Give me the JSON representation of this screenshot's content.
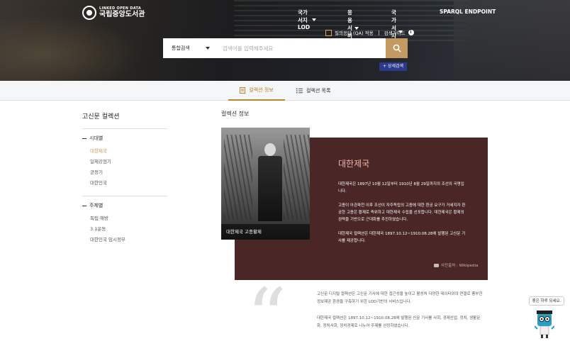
{
  "logo": {
    "sub": "LINKED OPEN DATA",
    "main": "국립중앙도서관"
  },
  "nav": [
    {
      "label": "국가서지 LOD",
      "dropdown": true
    },
    {
      "label": "응용서비스",
      "dropdown": true
    },
    {
      "label": "국가서지 컬스",
      "dropdown": true
    },
    {
      "label": "SPARQL ENDPOINT",
      "dropdown": false
    }
  ],
  "qa": {
    "label": "질의응답 (QA) 적용",
    "guide": "검색가이드"
  },
  "search": {
    "category": "통합검색",
    "placeholder": "검색어를 입력해주세요",
    "advanced": "+ 상세검색"
  },
  "tabs": [
    {
      "label": "컬렉션 정보",
      "active": true
    },
    {
      "label": "컬렉션 목록",
      "active": false
    }
  ],
  "sidebar": {
    "title": "고신문 컬렉션",
    "groups": [
      {
        "label": "시대별",
        "items": [
          "대한제국",
          "일제강점기",
          "군정기",
          "대한민국"
        ],
        "active": 0
      },
      {
        "label": "주제별",
        "items": [
          "독립·해방",
          "3.1운동",
          "대한민국 임시정부"
        ]
      }
    ]
  },
  "main": {
    "section_title": "컬렉션 정보",
    "photo_caption": "대한제국 고종황제",
    "feature_title": "대한제국",
    "feature_paragraphs": [
      "대한제국은 1897년 10월 12일부터 1910년 8월 29일까지의 조선의 국명입니다.",
      "고종이 아관파천 이후 조선이 자주독립의 고종에 대한 환궁 요구가 거세지자 환궁한 고종은 황제로 즉위하고 대한제국 수립을 선포합니다. 대한제국은 황제의 권력을 기반으로 근대화를 추진하였습니다.",
      "대한제국 컬렉션은 대한제국 1897.10.12~1910.08.28에 발행된 고신문 기사를 제공합니다."
    ],
    "credit": "사진출처 : Wikipedia",
    "descriptions": [
      "고신문 디지털 컬렉션은 고신문 기사에 대한 접근성을 높이고 활성처 다양한 데이터와의 연결로 풍부한 정보제공 환경을 구축하기 위한 LOD기반의 서비스입니다.",
      "대한제국 컬렉션은 1897.10.12~1910.08.28에 발행된 신문 기사를 사회, 경제산업, 정치, 생활문화, 정치사회, 정치경제로 나누어 주제를 선정하였습니다."
    ]
  },
  "chat": {
    "bubble": "좋은 하루 되세요."
  },
  "colors": {
    "accent": "#c39a5f",
    "feature_bg": "#4a2626",
    "advanced_btn": "#2b3a8a",
    "feature_title": "#f0b7a8"
  }
}
